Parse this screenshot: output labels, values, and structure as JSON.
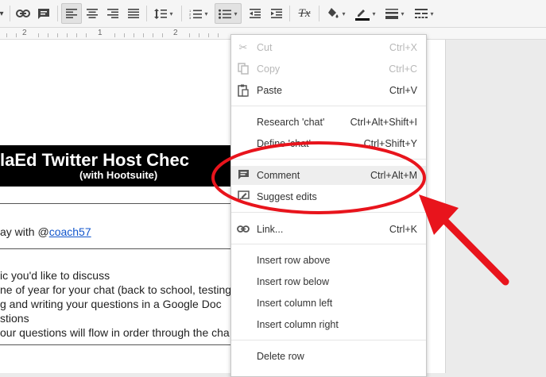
{
  "toolbar": {
    "icons": [
      "link-icon",
      "insert-comment-icon",
      "align-left-icon",
      "align-center-icon",
      "align-right-icon",
      "align-justify-icon",
      "line-spacing-icon",
      "numbered-list-icon",
      "bulleted-list-icon",
      "decrease-indent-icon",
      "increase-indent-icon",
      "clear-formatting-icon",
      "fill-color-icon",
      "border-color-icon",
      "border-weight-icon",
      "border-dash-icon"
    ],
    "clear_format_glyph": "Tx"
  },
  "ruler": {
    "marks": [
      "2",
      "1",
      "2"
    ]
  },
  "document": {
    "banner_title": "laEd Twitter Host Chec",
    "banner_subtitle": "(with Hootsuite)",
    "line_prefix": "ay with @",
    "line_link": "coach57",
    "list_lines": [
      "ic you'd like to discuss",
      "ne of year for your chat (back to school, testing",
      "g and writing your questions in a Google Doc",
      "stions",
      "our questions will flow in order through the cha"
    ]
  },
  "context_menu": {
    "cut": {
      "label": "Cut",
      "shortcut": "Ctrl+X",
      "icon": "scissors-icon"
    },
    "copy": {
      "label": "Copy",
      "shortcut": "Ctrl+C",
      "icon": "copy-icon"
    },
    "paste": {
      "label": "Paste",
      "shortcut": "Ctrl+V",
      "icon": "paste-icon"
    },
    "research": {
      "label": "Research 'chat'",
      "shortcut": "Ctrl+Alt+Shift+I"
    },
    "define": {
      "label": "Define 'chat'",
      "shortcut": "Ctrl+Shift+Y"
    },
    "comment": {
      "label": "Comment",
      "shortcut": "Ctrl+Alt+M",
      "icon": "comment-icon"
    },
    "suggest": {
      "label": "Suggest edits",
      "icon": "suggest-edits-icon"
    },
    "link": {
      "label": "Link...",
      "shortcut": "Ctrl+K",
      "icon": "link-icon"
    },
    "insert_row_above": {
      "label": "Insert row above"
    },
    "insert_row_below": {
      "label": "Insert row below"
    },
    "insert_col_left": {
      "label": "Insert column left"
    },
    "insert_col_right": {
      "label": "Insert column right"
    },
    "delete_row": {
      "label": "Delete row"
    }
  },
  "colors": {
    "annotation": "#e8141c",
    "menu_highlight": "#eeeeee",
    "link": "#1155cc"
  }
}
